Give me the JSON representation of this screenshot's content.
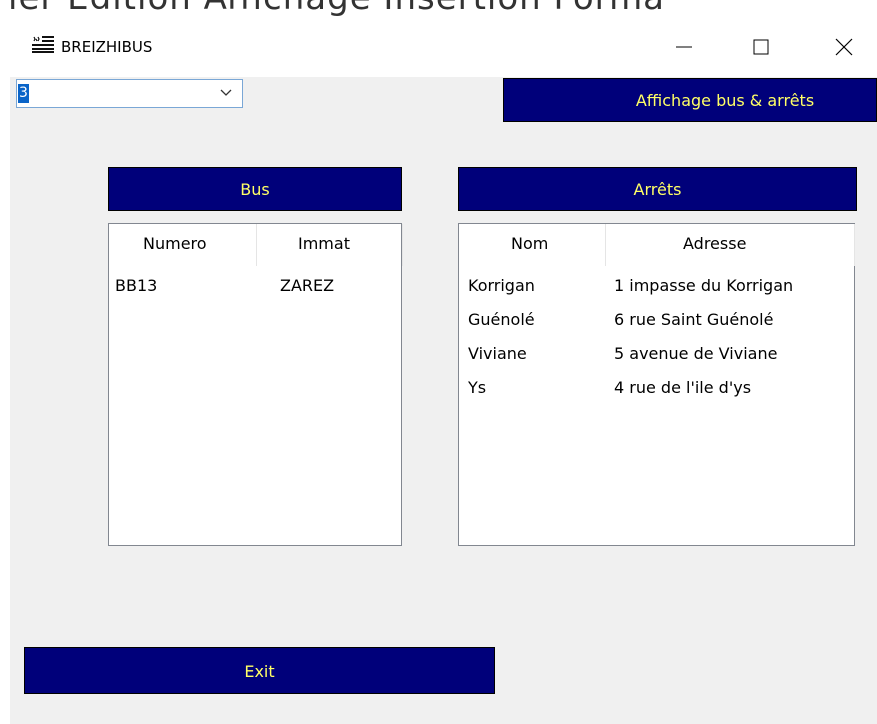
{
  "window": {
    "title": "BREIZHIBUS"
  },
  "background_menu": "ier Edition Affichage Insertion Forma",
  "combo": {
    "value": "3"
  },
  "buttons": {
    "affichage": "Affichage bus & arrêts",
    "exit": "Exit"
  },
  "bus": {
    "header": "Bus",
    "columns": [
      "Numero",
      "Immat"
    ],
    "rows": [
      [
        "BB13",
        "ZAREZ"
      ]
    ]
  },
  "arrets": {
    "header": "Arrêts",
    "columns": [
      "Nom",
      "Adresse"
    ],
    "rows": [
      [
        "Korrigan",
        "1 impasse du Korrigan"
      ],
      [
        "Guénolé",
        "6 rue Saint Guénolé"
      ],
      [
        "Viviane",
        "5 avenue de Viviane"
      ],
      [
        "Ys",
        "4 rue de l'ile d'ys"
      ]
    ]
  },
  "colors": {
    "button_bg": "#00007a",
    "button_text": "#ffff66",
    "window_bg": "#f0f0f0"
  }
}
